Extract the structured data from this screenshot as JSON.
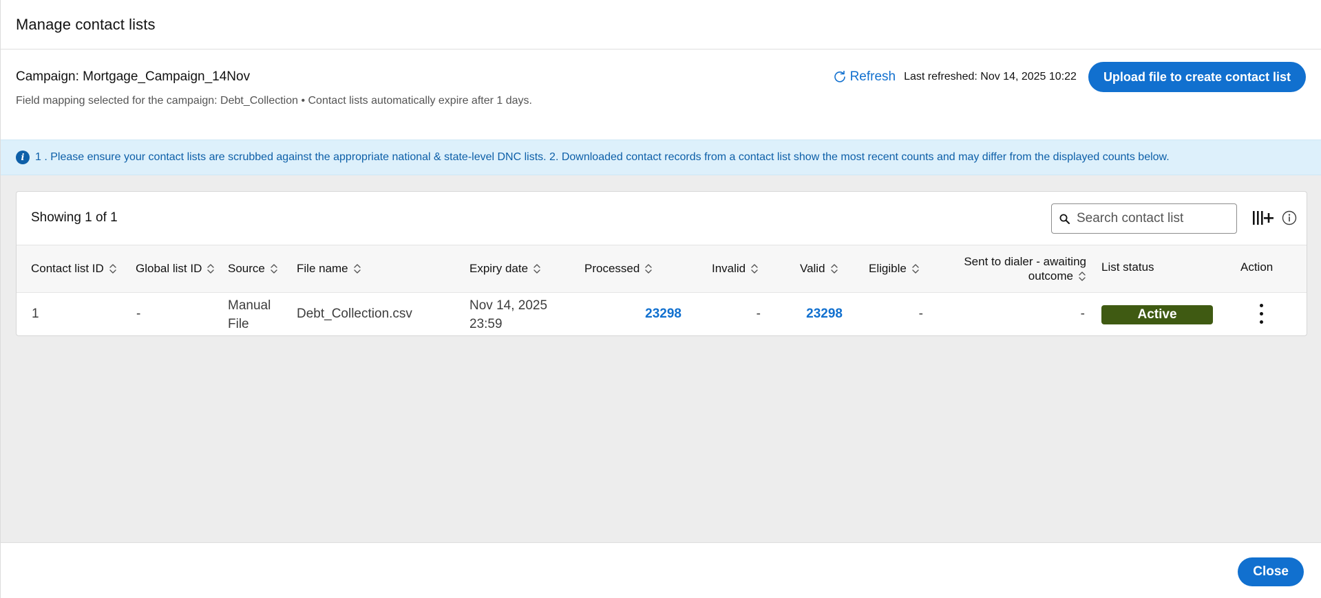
{
  "modal": {
    "title": "Manage contact lists",
    "close_label": "Close"
  },
  "campaign": {
    "title": "Campaign: Mortgage_Campaign_14Nov",
    "subtitle": "Field mapping selected for the campaign: Debt_Collection • Contact lists automatically expire after 1 days.",
    "refresh_label": "Refresh",
    "last_refreshed": "Last refreshed: Nov 14, 2025 10:22",
    "upload_label": "Upload file to create contact list"
  },
  "banner": {
    "text": "1 . Please ensure your contact lists are scrubbed against the appropriate national & state-level DNC lists. 2. Downloaded contact records from a contact list show the most recent counts and may differ from the displayed counts below."
  },
  "table": {
    "showing": "Showing 1 of 1",
    "search_placeholder": "Search contact list",
    "columns": [
      "Contact list ID",
      "Global list ID",
      "Source",
      "File name",
      "Expiry date",
      "Processed",
      "Invalid",
      "Valid",
      "Eligible",
      "Sent to dialer - awaiting",
      "outcome",
      "List status",
      "Action"
    ],
    "rows": [
      {
        "contact_list_id": "1",
        "global_list_id": "-",
        "source_line1": "Manual",
        "source_line2": "File",
        "file_name": "Debt_Collection.csv",
        "expiry_line1": "Nov 14, 2025",
        "expiry_line2": "23:59",
        "processed": "23298",
        "invalid": "-",
        "valid": "23298",
        "eligible": "-",
        "sent_to_dialer": "-",
        "status": "Active"
      }
    ]
  },
  "colors": {
    "primary": "#1170cf",
    "banner_bg": "#ddf0fb",
    "banner_text": "#0d5fa8",
    "active_badge": "#3f5a12",
    "content_bg": "#ededed"
  }
}
